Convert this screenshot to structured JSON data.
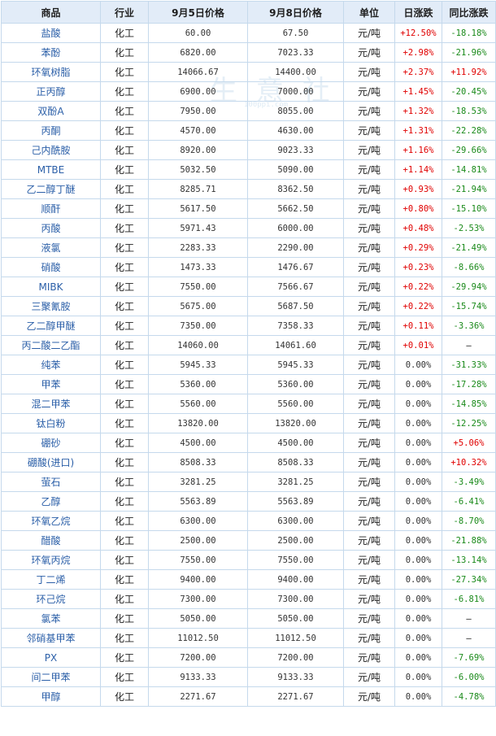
{
  "watermark": "生 意 社",
  "watermark_url": "100ppi.com",
  "headers": [
    "商品",
    "行业",
    "9月5日价格",
    "9月8日价格",
    "单位",
    "日涨跌",
    "同比涨跌"
  ],
  "rows": [
    [
      "盐酸",
      "化工",
      "60.00",
      "67.50",
      "元/吨",
      "+12.50%",
      "-18.18%"
    ],
    [
      "苯酚",
      "化工",
      "6820.00",
      "7023.33",
      "元/吨",
      "+2.98%",
      "-21.96%"
    ],
    [
      "环氧树脂",
      "化工",
      "14066.67",
      "14400.00",
      "元/吨",
      "+2.37%",
      "+11.92%"
    ],
    [
      "正丙醇",
      "化工",
      "6900.00",
      "7000.00",
      "元/吨",
      "+1.45%",
      "-20.45%"
    ],
    [
      "双酚A",
      "化工",
      "7950.00",
      "8055.00",
      "元/吨",
      "+1.32%",
      "-18.53%"
    ],
    [
      "丙酮",
      "化工",
      "4570.00",
      "4630.00",
      "元/吨",
      "+1.31%",
      "-22.28%"
    ],
    [
      "己内酰胺",
      "化工",
      "8920.00",
      "9023.33",
      "元/吨",
      "+1.16%",
      "-29.66%"
    ],
    [
      "MTBE",
      "化工",
      "5032.50",
      "5090.00",
      "元/吨",
      "+1.14%",
      "-14.81%"
    ],
    [
      "乙二醇丁醚",
      "化工",
      "8285.71",
      "8362.50",
      "元/吨",
      "+0.93%",
      "-21.94%"
    ],
    [
      "顺酐",
      "化工",
      "5617.50",
      "5662.50",
      "元/吨",
      "+0.80%",
      "-15.10%"
    ],
    [
      "丙酸",
      "化工",
      "5971.43",
      "6000.00",
      "元/吨",
      "+0.48%",
      "-2.53%"
    ],
    [
      "液氯",
      "化工",
      "2283.33",
      "2290.00",
      "元/吨",
      "+0.29%",
      "-21.49%"
    ],
    [
      "硝酸",
      "化工",
      "1473.33",
      "1476.67",
      "元/吨",
      "+0.23%",
      "-8.66%"
    ],
    [
      "MIBK",
      "化工",
      "7550.00",
      "7566.67",
      "元/吨",
      "+0.22%",
      "-29.94%"
    ],
    [
      "三聚氰胺",
      "化工",
      "5675.00",
      "5687.50",
      "元/吨",
      "+0.22%",
      "-15.74%"
    ],
    [
      "乙二醇甲醚",
      "化工",
      "7350.00",
      "7358.33",
      "元/吨",
      "+0.11%",
      "-3.36%"
    ],
    [
      "丙二酸二乙酯",
      "化工",
      "14060.00",
      "14061.60",
      "元/吨",
      "+0.01%",
      "—"
    ],
    [
      "纯苯",
      "化工",
      "5945.33",
      "5945.33",
      "元/吨",
      "0.00%",
      "-31.33%"
    ],
    [
      "甲苯",
      "化工",
      "5360.00",
      "5360.00",
      "元/吨",
      "0.00%",
      "-17.28%"
    ],
    [
      "混二甲苯",
      "化工",
      "5560.00",
      "5560.00",
      "元/吨",
      "0.00%",
      "-14.85%"
    ],
    [
      "钛白粉",
      "化工",
      "13820.00",
      "13820.00",
      "元/吨",
      "0.00%",
      "-12.25%"
    ],
    [
      "硼砂",
      "化工",
      "4500.00",
      "4500.00",
      "元/吨",
      "0.00%",
      "+5.06%"
    ],
    [
      "硼酸(进口)",
      "化工",
      "8508.33",
      "8508.33",
      "元/吨",
      "0.00%",
      "+10.32%"
    ],
    [
      "萤石",
      "化工",
      "3281.25",
      "3281.25",
      "元/吨",
      "0.00%",
      "-3.49%"
    ],
    [
      "乙醇",
      "化工",
      "5563.89",
      "5563.89",
      "元/吨",
      "0.00%",
      "-6.41%"
    ],
    [
      "环氧乙烷",
      "化工",
      "6300.00",
      "6300.00",
      "元/吨",
      "0.00%",
      "-8.70%"
    ],
    [
      "醋酸",
      "化工",
      "2500.00",
      "2500.00",
      "元/吨",
      "0.00%",
      "-21.88%"
    ],
    [
      "环氧丙烷",
      "化工",
      "7550.00",
      "7550.00",
      "元/吨",
      "0.00%",
      "-13.14%"
    ],
    [
      "丁二烯",
      "化工",
      "9400.00",
      "9400.00",
      "元/吨",
      "0.00%",
      "-27.34%"
    ],
    [
      "环己烷",
      "化工",
      "7300.00",
      "7300.00",
      "元/吨",
      "0.00%",
      "-6.81%"
    ],
    [
      "氯苯",
      "化工",
      "5050.00",
      "5050.00",
      "元/吨",
      "0.00%",
      "—"
    ],
    [
      "邻硝基甲苯",
      "化工",
      "11012.50",
      "11012.50",
      "元/吨",
      "0.00%",
      "—"
    ],
    [
      "PX",
      "化工",
      "7200.00",
      "7200.00",
      "元/吨",
      "0.00%",
      "-7.69%"
    ],
    [
      "间二甲苯",
      "化工",
      "9133.33",
      "9133.33",
      "元/吨",
      "0.00%",
      "-6.00%"
    ],
    [
      "甲醇",
      "化工",
      "2271.67",
      "2271.67",
      "元/吨",
      "0.00%",
      "-4.78%"
    ]
  ],
  "colors": {
    "up": "#e00000",
    "down": "#1a8a1a",
    "name": "#2b5fa8",
    "header_bg": "#e2ecf8",
    "border": "#c5d9ec"
  }
}
